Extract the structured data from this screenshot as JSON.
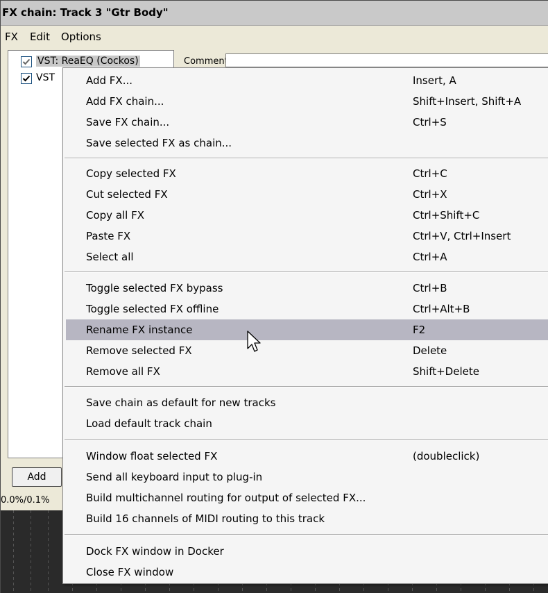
{
  "window": {
    "title": "FX chain: Track 3 \"Gtr Body\""
  },
  "menubar": {
    "items": [
      "FX",
      "Edit",
      "Options"
    ]
  },
  "fx_list": {
    "items": [
      {
        "label": "VST: ReaEQ (Cockos)",
        "checked": true,
        "selected": true
      },
      {
        "label": "VST",
        "checked": true,
        "selected": false
      }
    ]
  },
  "comment": {
    "label": "Comment:",
    "value": ""
  },
  "add_button": {
    "label": "Add"
  },
  "status": {
    "cpu": "0.0%/0.1%"
  },
  "context_menu": {
    "items": [
      {
        "label": "Add FX...",
        "shortcut": "Insert, A"
      },
      {
        "label": "Add FX chain...",
        "shortcut": "Shift+Insert, Shift+A"
      },
      {
        "label": "Save FX chain...",
        "shortcut": "Ctrl+S"
      },
      {
        "label": "Save selected FX as chain...",
        "shortcut": ""
      },
      {
        "label": "Copy selected FX",
        "shortcut": "Ctrl+C"
      },
      {
        "label": "Cut selected FX",
        "shortcut": "Ctrl+X"
      },
      {
        "label": "Copy all FX",
        "shortcut": "Ctrl+Shift+C"
      },
      {
        "label": "Paste FX",
        "shortcut": "Ctrl+V, Ctrl+Insert"
      },
      {
        "label": "Select all",
        "shortcut": "Ctrl+A"
      },
      {
        "label": "Toggle selected FX bypass",
        "shortcut": "Ctrl+B"
      },
      {
        "label": "Toggle selected FX offline",
        "shortcut": "Ctrl+Alt+B"
      },
      {
        "label": "Rename FX instance",
        "shortcut": "F2",
        "highlighted": true
      },
      {
        "label": "Remove selected FX",
        "shortcut": "Delete"
      },
      {
        "label": "Remove all FX",
        "shortcut": "Shift+Delete"
      },
      {
        "label": "Save chain as default for new tracks",
        "shortcut": ""
      },
      {
        "label": "Load default track chain",
        "shortcut": ""
      },
      {
        "label": "Window float selected FX",
        "shortcut": "(doubleclick)"
      },
      {
        "label": "Send all keyboard input to plug-in",
        "shortcut": ""
      },
      {
        "label": "Build multichannel routing for output of selected FX...",
        "shortcut": ""
      },
      {
        "label": "Build 16 channels of MIDI routing to this track",
        "shortcut": ""
      },
      {
        "label": "Dock FX window in Docker",
        "shortcut": ""
      },
      {
        "label": "Close FX window",
        "shortcut": ""
      }
    ]
  },
  "colors": {
    "highlight": "#b7b6c2",
    "menu_bg": "#f5f5f5",
    "window_bg": "#ece9d8",
    "timeline_bg": "#2a2a2a"
  }
}
